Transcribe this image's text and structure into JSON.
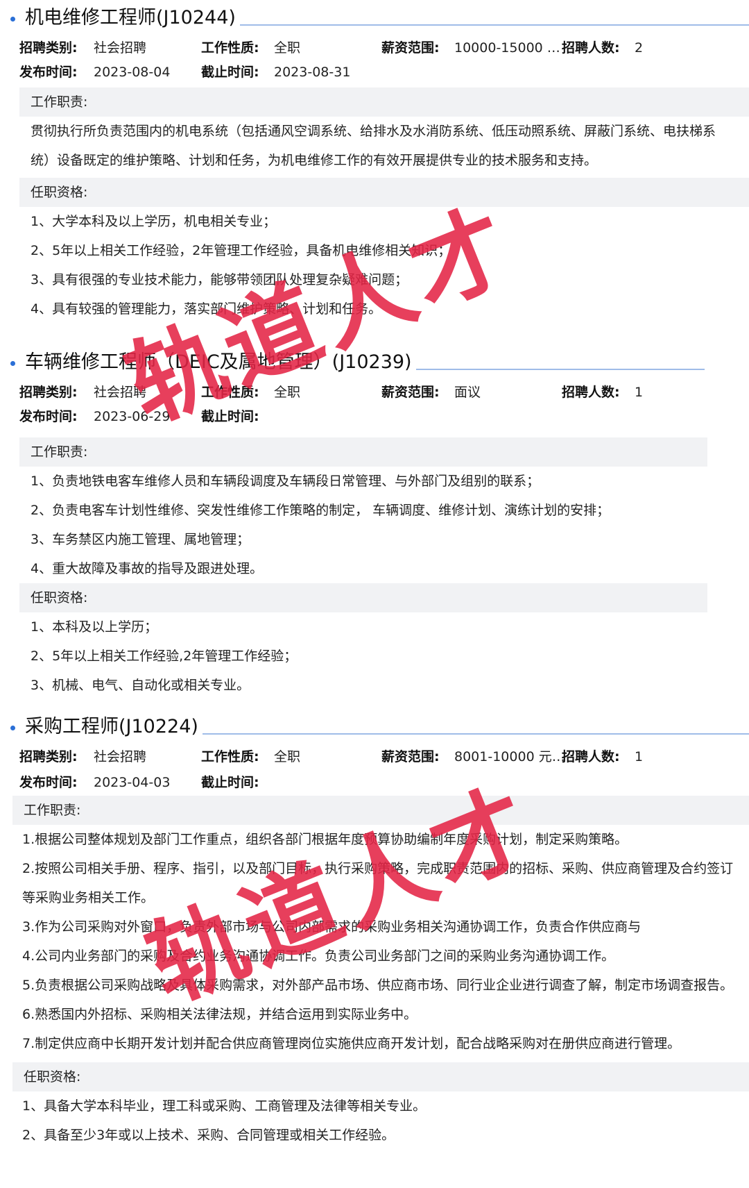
{
  "labels": {
    "category": "招聘类别:",
    "nature": "工作性质:",
    "salary": "薪资范围:",
    "headcount": "招聘人数:",
    "publish": "发布时间:",
    "deadline": "截止时间:",
    "duties": "工作职责:",
    "qualifications": "任职资格:"
  },
  "jobs": [
    {
      "title": "机电维修工程师(J10244)",
      "category": "社会招聘",
      "nature": "全职",
      "salary": "10000-15000 …",
      "headcount": "2",
      "publish": "2023-08-04",
      "deadline": "2023-08-31",
      "duties": [
        "贯彻执行所负责范围内的机电系统（包括通风空调系统、给排水及水消防系统、低压动照系统、屏蔽门系统、电扶梯系统）设备既定的维护策略、计划和任务，为机电维修工作的有效开展提供专业的技术服务和支持。"
      ],
      "qualifications": [
        "1、大学本科及以上学历，机电相关专业；",
        "2、5年以上相关工作经验，2年管理工作经验，具备机电维修相关知识；",
        "3、具有很强的专业技术能力，能够带领团队处理复杂疑难问题；",
        "4、具有较强的管理能力，落实部门维护策略、计划和任务。"
      ]
    },
    {
      "title": "车辆维修工程师（DEIC及属地管理）(J10239)",
      "category": "社会招聘",
      "nature": "全职",
      "salary": "面议",
      "headcount": "1",
      "publish": "2023-06-29",
      "deadline": "",
      "duties": [
        "1、负责地铁电客车维修人员和车辆段调度及车辆段日常管理、与外部门及组别的联系；",
        "2、负责电客车计划性维修、突发性维修工作策略的制定， 车辆调度、维修计划、演练计划的安排；",
        "3、车务禁区内施工管理、属地管理；",
        "4、重大故障及事故的指导及跟进处理。"
      ],
      "qualifications": [
        "1、本科及以上学历；",
        "2、5年以上相关工作经验,2年管理工作经验；",
        "3、机械、电气、自动化或相关专业。"
      ]
    },
    {
      "title": "采购工程师(J10224)",
      "category": "社会招聘",
      "nature": "全职",
      "salary": "8001-10000 元…",
      "headcount": "1",
      "publish": "2023-04-03",
      "deadline": "",
      "duties": [
        "1.根据公司整体规划及部门工作重点，组织各部门根据年度预算协助编制年度采购计划，制定采购策略。",
        "2.按照公司相关手册、程序、指引，以及部门目标，执行采购策略，完成职责范围内的招标、采购、供应商管理及合约签订等采购业务相关工作。",
        "3.作为公司采购对外窗口，负责外部市场与公司内部需求的采购业务相关沟通协调工作，负责合作供应商与",
        "4.公司内业务部门的采购及合约业务沟通协调工作。负责公司业务部门之间的采购业务沟通协调工作。",
        "5.负责根据公司采购战略及具体采购需求，对外部产品市场、供应商市场、同行业企业进行调查了解，制定市场调查报告。",
        "6.熟悉国内外招标、采购相关法律法规，并结合运用到实际业务中。",
        "7.制定供应商中长期开发计划并配合供应商管理岗位实施供应商开发计划，配合战略采购对在册供应商进行管理。"
      ],
      "qualifications": [
        "1、具备大学本科毕业，理工科或采购、工商管理及法律等相关专业。",
        "2、具备至少3年或以上技术、采购、合同管理或相关工作经验。"
      ]
    }
  ],
  "watermark": "轨道人才",
  "colors": {
    "accent": "#2b6fd6",
    "watermark": "#e42446"
  }
}
